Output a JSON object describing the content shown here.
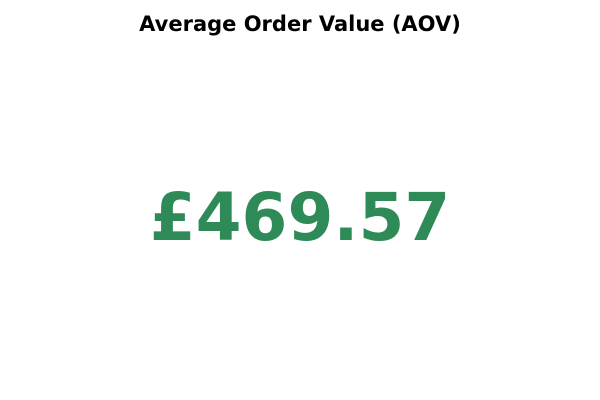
{
  "chart_data": {
    "type": "table",
    "title": "Average Order Value (AOV)",
    "value": 469.57,
    "value_display": "£469.57",
    "currency": "£",
    "value_color": "#2e8b57"
  }
}
